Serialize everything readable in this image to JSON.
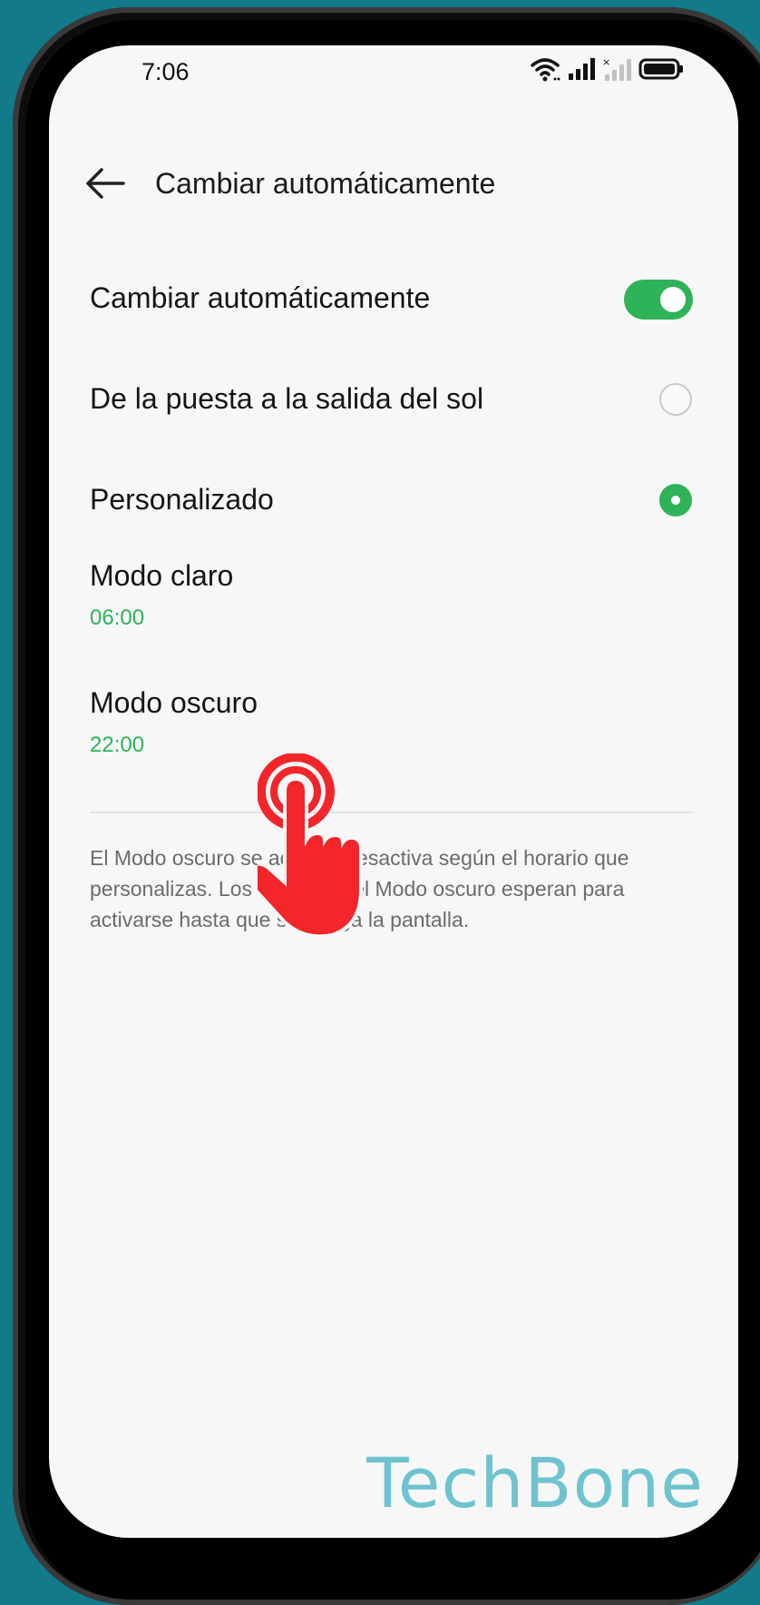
{
  "status_bar": {
    "time": "7:06",
    "icons": [
      "wifi-icon",
      "signal-icon",
      "signal-no-sim-icon",
      "battery-icon"
    ]
  },
  "header": {
    "back_icon": "back-arrow-icon",
    "title": "Cambiar automáticamente"
  },
  "settings": {
    "auto_switch": {
      "label": "Cambiar automáticamente",
      "enabled": true
    },
    "sunset_option": {
      "label": "De la puesta a la salida del sol",
      "selected": false
    },
    "custom_option": {
      "label": "Personalizado",
      "selected": true
    },
    "light_mode": {
      "label": "Modo claro",
      "time": "06:00"
    },
    "dark_mode": {
      "label": "Modo oscuro",
      "time": "22:00"
    }
  },
  "description": "El Modo oscuro se activa y desactiva según el horario que personalizas. Los cambios del Modo oscuro esperan para activarse hasta que se apaga la pantalla.",
  "colors": {
    "accent": "#2eb358",
    "background": "#f7f7f7",
    "tap_indicator": "#f2252a",
    "watermark": "#6fc3cf"
  },
  "watermark": "TechBone"
}
